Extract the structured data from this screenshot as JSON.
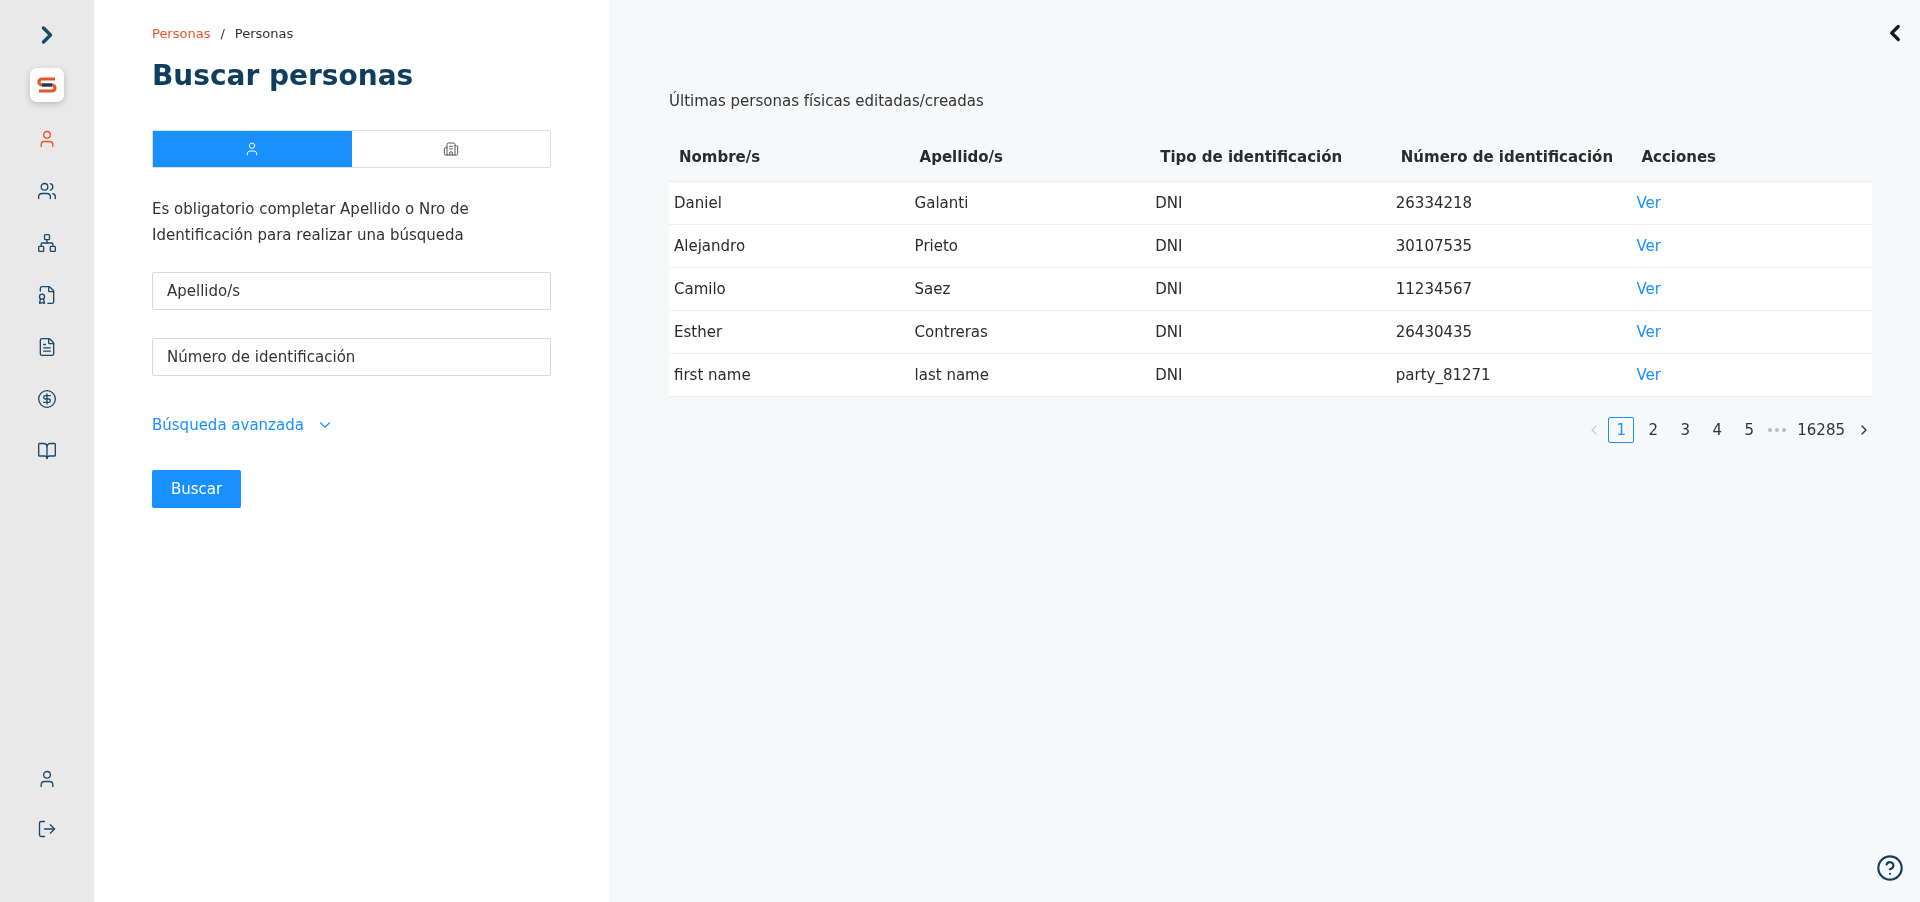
{
  "sidebar": {
    "items": [
      {
        "selected": true
      },
      {
        "selected": false
      },
      {
        "selected": false
      },
      {
        "selected": false
      },
      {
        "selected": false
      },
      {
        "selected": false
      },
      {
        "selected": false
      }
    ]
  },
  "breadcrumb": [
    {
      "label": "Personas",
      "kind": "link"
    },
    {
      "label": "Personas",
      "kind": "current"
    }
  ],
  "breadcrumb_separator": "/",
  "title": "Buscar personas",
  "type_tabs": [
    {
      "selected": true
    },
    {
      "selected": false
    }
  ],
  "notice": "Es obligatorio completar Apellido o Nro de Identificación para realizar una búsqueda",
  "fields": [
    {
      "placeholder": "Apellido/s"
    },
    {
      "placeholder": "Número de identificación"
    }
  ],
  "advanced_search": {
    "label": "Búsqueda avanzada",
    "expanded": false
  },
  "search_button": "Buscar",
  "recent": {
    "heading": "Últimas personas físicas editadas/creadas",
    "columns": [
      "Nombre/s",
      "Apellido/s",
      "Tipo de identificación",
      "Número de identificación",
      "Acciones"
    ],
    "rows": [
      [
        "Daniel",
        "Galanti",
        "DNI",
        "26334218",
        "Ver"
      ],
      [
        "Alejandro",
        "Prieto",
        "DNI",
        "30107535",
        "Ver"
      ],
      [
        "Camilo",
        "Saez",
        "DNI",
        "11234567",
        "Ver"
      ],
      [
        "Esther",
        "Contreras",
        "DNI",
        "26430435",
        "Ver"
      ],
      [
        "first name",
        "last name",
        "DNI",
        "party_81271",
        "Ver"
      ]
    ]
  },
  "pagination": {
    "pages": [
      {
        "label": "1",
        "selected": true
      },
      {
        "label": "2",
        "selected": false
      },
      {
        "label": "3",
        "selected": false
      },
      {
        "label": "4",
        "selected": false
      },
      {
        "label": "5",
        "selected": false
      }
    ],
    "last": "16285",
    "prev_disabled": true
  }
}
